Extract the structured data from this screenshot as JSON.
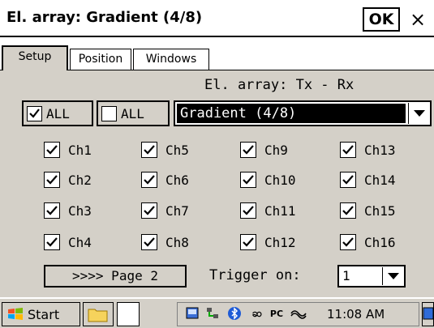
{
  "window": {
    "title": "El. array: Gradient (4/8)",
    "ok_label": "OK",
    "close_label": "×"
  },
  "tabs": [
    {
      "label": "Setup",
      "active": true
    },
    {
      "label": "Position",
      "active": false
    },
    {
      "label": "Windows",
      "active": false
    }
  ],
  "setup": {
    "array_label": "El. array: Tx - Rx",
    "all_checked": {
      "label": "ALL",
      "checked": true
    },
    "all_unchecked": {
      "label": "ALL",
      "checked": false
    },
    "array_select": {
      "value": "Gradient (4/8)"
    },
    "channels": [
      {
        "label": "Ch1",
        "checked": true
      },
      {
        "label": "Ch5",
        "checked": true
      },
      {
        "label": "Ch9",
        "checked": true
      },
      {
        "label": "Ch13",
        "checked": true
      },
      {
        "label": "Ch2",
        "checked": true
      },
      {
        "label": "Ch6",
        "checked": true
      },
      {
        "label": "Ch10",
        "checked": true
      },
      {
        "label": "Ch14",
        "checked": true
      },
      {
        "label": "Ch3",
        "checked": true
      },
      {
        "label": "Ch7",
        "checked": true
      },
      {
        "label": "Ch11",
        "checked": true
      },
      {
        "label": "Ch15",
        "checked": true
      },
      {
        "label": "Ch4",
        "checked": true
      },
      {
        "label": "Ch8",
        "checked": true
      },
      {
        "label": "Ch12",
        "checked": true
      },
      {
        "label": "Ch16",
        "checked": true
      }
    ],
    "page_button": ">>>> Page 2",
    "trigger_label": "Trigger on:",
    "trigger_select": {
      "value": "1"
    }
  },
  "taskbar": {
    "start_label": "Start",
    "clock": "11:08 AM",
    "tray_icons": [
      "keyboard-icon",
      "network-icon",
      "bluetooth-icon",
      "sync-icon",
      "pc-icon",
      "activesync-icon"
    ]
  },
  "colors": {
    "window_bg": "#d4d0c8",
    "selection_bg": "#000000",
    "title_bg": "#ffffff"
  }
}
